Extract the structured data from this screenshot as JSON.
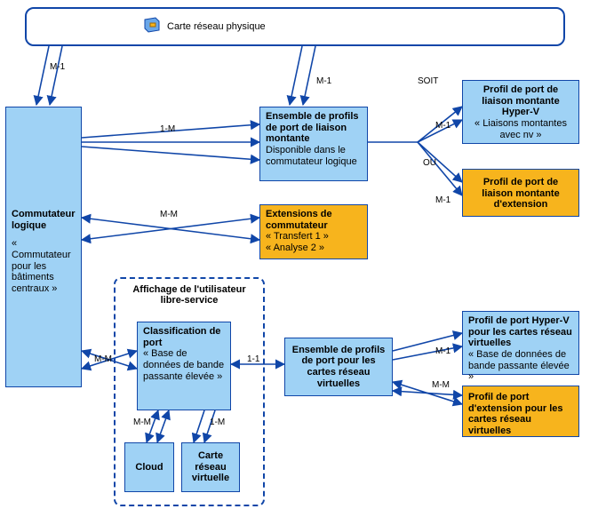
{
  "top": {
    "title": "Carte réseau physique"
  },
  "labels": {
    "m1_left": "M-1",
    "m1_mid": "M-1",
    "one_m": "1-M",
    "soit": "SOIT",
    "ou": "OU",
    "m1_a": "M-1",
    "m1_b": "M-1",
    "mm_ext": "M-M",
    "mm_port": "M-M",
    "one_one": "1-1",
    "mm_cloud": "M-M",
    "one_m_vnic": "1-M",
    "m1_hyperv_vnic": "M-1",
    "mm_ext_vnic": "M-M"
  },
  "nodes": {
    "commutateur": {
      "title": "Commutateur logique",
      "sub": "« Commutateur pour les bâtiments centraux »"
    },
    "uplink_set": {
      "title": "Ensemble de profils de port de liaison montante",
      "sub": "Disponible dans le commutateur logique"
    },
    "ext_commut": {
      "title": "Extensions de commutateur",
      "sub1": "« Transfert 1 »",
      "sub2": "« Analyse 2 »"
    },
    "hyperv_uplink": {
      "title": "Profil de port de liaison montante Hyper-V",
      "sub": "« Liaisons montantes avec nv »"
    },
    "ext_uplink": {
      "title": "Profil de port de liaison montante d'extension"
    },
    "self_service": {
      "title": "Affichage de l'utilisateur libre-service"
    },
    "port_class": {
      "title": "Classification de port",
      "sub": "« Base de données de bande passante élevée »"
    },
    "cloud": {
      "title": "Cloud"
    },
    "vnic": {
      "title": "Carte réseau virtuelle"
    },
    "vnic_set": {
      "title": "Ensemble de profils de port pour les cartes réseau virtuelles"
    },
    "hyperv_vnic": {
      "title": "Profil de port Hyper-V pour les cartes réseau virtuelles",
      "sub": "« Base de données de bande passante élevée »"
    },
    "ext_vnic": {
      "title": "Profil de port d'extension pour les cartes réseau virtuelles"
    }
  }
}
